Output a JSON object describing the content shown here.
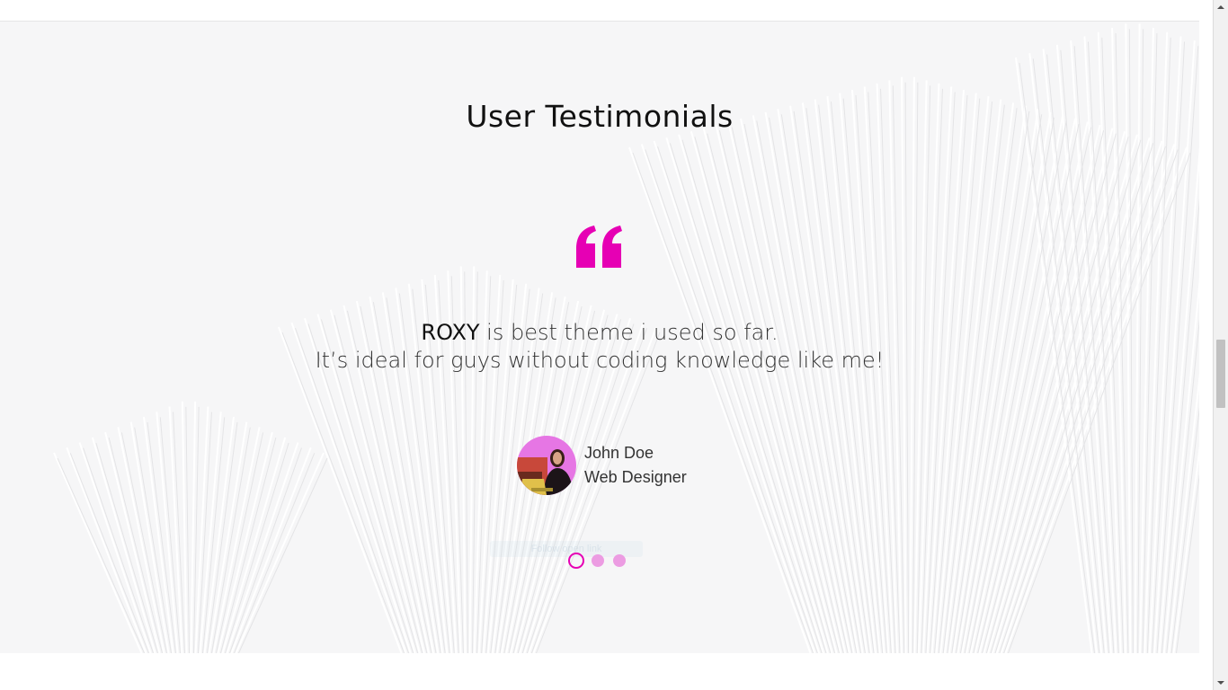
{
  "page": {
    "accent_color": "#e600b4",
    "section": {
      "title": "User Testimonials"
    },
    "testimonial": {
      "quote_icon": "quote-icon",
      "brand": "ROXY",
      "line1_rest": " is best theme i used so far.",
      "line2": "It’s ideal for guys without coding knowledge like me!",
      "author_name": "John Doe",
      "author_role": "Web Designer",
      "avatar_icon": "avatar-photo"
    },
    "ghost_button_label": "Follow open link",
    "carousel": {
      "slides": 3,
      "active_index": 0
    },
    "scrollbar": {
      "up_icon": "arrow-up-icon",
      "down_icon": "arrow-down-icon"
    }
  }
}
